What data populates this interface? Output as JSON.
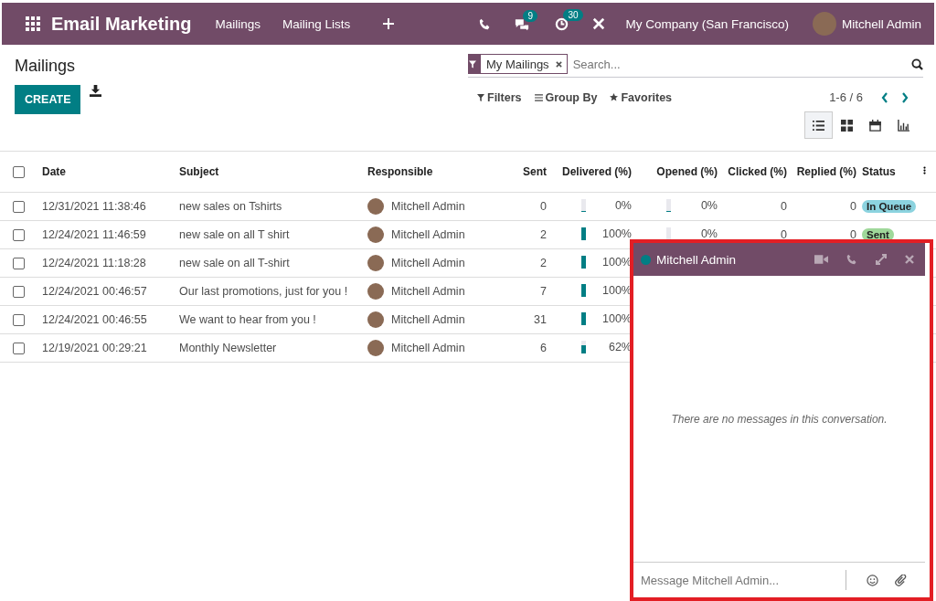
{
  "navbar": {
    "title": "Email Marketing",
    "menu": [
      "Mailings",
      "Mailing Lists"
    ],
    "messages_count": "9",
    "activities_count": "30",
    "company": "My Company (San Francisco)",
    "user": "Mitchell Admin"
  },
  "control_panel": {
    "title": "Mailings",
    "create": "CREATE",
    "facet": "My Mailings",
    "search_placeholder": "Search...",
    "search_options": [
      "Filters",
      "Group By",
      "Favorites"
    ],
    "pager": "1-6 / 6",
    "views": [
      {
        "kind": "list",
        "selected": true
      },
      {
        "kind": "kanban",
        "selected": false
      },
      {
        "kind": "calendar",
        "selected": false
      },
      {
        "kind": "graph",
        "selected": false
      }
    ]
  },
  "table": {
    "select_all_checked": false,
    "columns": [
      "Date",
      "Subject",
      "Responsible",
      "Sent",
      "Delivered (%)",
      "Opened (%)",
      "Clicked (%)",
      "Replied (%)",
      "Status"
    ],
    "rows": [
      {
        "checked": false,
        "date": "12/31/2021 11:38:46",
        "subject": "new sales on Tshirts",
        "responsible": "Mitchell Admin",
        "sent": "0",
        "delivered": "0%",
        "delivered_level": {
          "level": 0
        },
        "opened": "0%",
        "opened_level": {
          "level": 0
        },
        "clicked": "0",
        "replied": "0",
        "status": {
          "label": "In Queue",
          "color": "#8cd3df"
        }
      },
      {
        "checked": false,
        "date": "12/24/2021 11:46:59",
        "subject": "new sale on all T shirt",
        "responsible": "Mitchell Admin",
        "sent": "2",
        "delivered": "100%",
        "delivered_level": {
          "level": 1
        },
        "opened": "0%",
        "opened_level": {
          "level": 0
        },
        "clicked": "0",
        "replied": "0",
        "status": {
          "label": "Sent",
          "color": "#9fd89a"
        }
      },
      {
        "checked": false,
        "date": "12/24/2021 11:18:28",
        "subject": "new sale on all T-shirt",
        "responsible": "Mitchell Admin",
        "sent": "2",
        "delivered": "100%",
        "delivered_level": {
          "level": 1
        }
      },
      {
        "checked": false,
        "date": "12/24/2021 00:46:57",
        "subject": "Our last promotions, just for you !",
        "responsible": "Mitchell Admin",
        "sent": "7",
        "delivered": "100%",
        "delivered_level": {
          "level": 1
        }
      },
      {
        "checked": false,
        "date": "12/24/2021 00:46:55",
        "subject": "We want to hear from you !",
        "responsible": "Mitchell Admin",
        "sent": "31",
        "delivered": "100%",
        "delivered_level": {
          "level": 1
        }
      },
      {
        "checked": false,
        "date": "12/19/2021 00:29:21",
        "subject": "Monthly Newsletter",
        "responsible": "Mitchell Admin",
        "sent": "6",
        "delivered": "62%",
        "delivered_level": {
          "level": 0.62
        }
      }
    ]
  },
  "chat": {
    "name": "Mitchell Admin",
    "online": true,
    "empty_text": "There are no messages in this conversation.",
    "placeholder": "Message Mitchell Admin..."
  }
}
